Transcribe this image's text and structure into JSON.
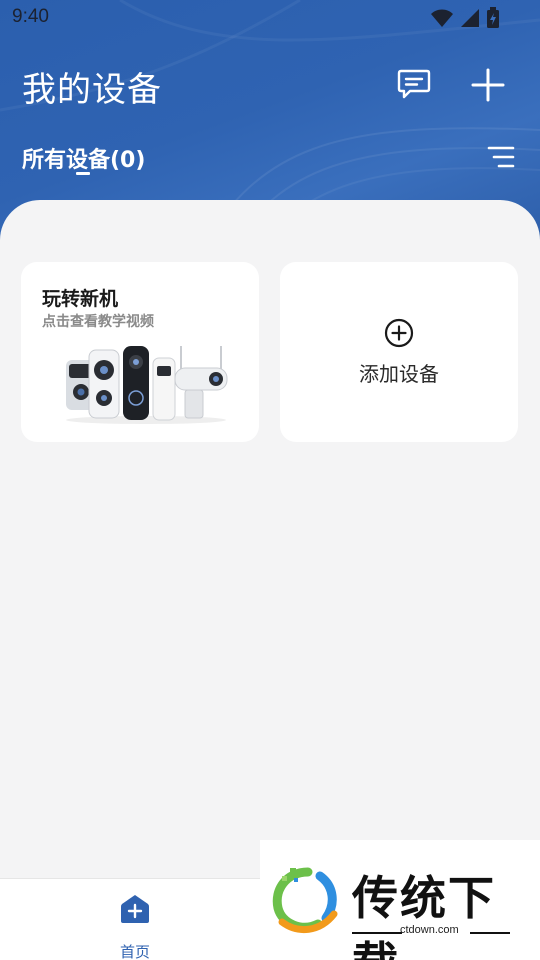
{
  "status_bar": {
    "time": "9:40",
    "icons": [
      "wifi-icon",
      "signal-icon",
      "battery-charging-icon"
    ]
  },
  "header": {
    "title": "我的设备",
    "actions": [
      {
        "name": "message",
        "icon": "message-icon"
      },
      {
        "name": "add",
        "icon": "plus-icon"
      }
    ],
    "filter_label": "所有设备(0)",
    "sort_icon": "sort-lines-icon"
  },
  "cards": {
    "guide": {
      "title": "玩转新机",
      "subtitle": "点击查看教学视频"
    },
    "add_device": {
      "label": "添加设备",
      "icon": "plus-circle-icon"
    }
  },
  "bottom_nav": {
    "items": [
      {
        "label": "首页",
        "icon": "home-icon",
        "active": true
      }
    ]
  },
  "watermark": {
    "text": "传统下载",
    "url": "ctdown.com"
  },
  "colors": {
    "header_blue": "#2f63b2",
    "accent": "#2f62b0",
    "background": "#f4f4f5"
  }
}
